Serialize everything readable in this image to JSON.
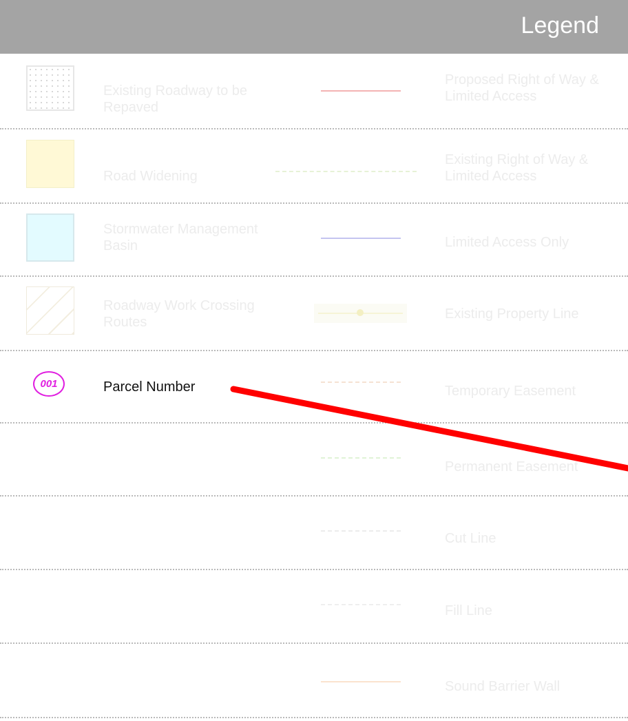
{
  "header": {
    "title": "Legend"
  },
  "left_items": [
    {
      "label": "Existing Roadway to be Repaved",
      "icon": "dotted-hatch-square-icon",
      "color": "#dcdcdc"
    },
    {
      "label": "Road Widening",
      "icon": "yellow-square-icon",
      "color": "#fff9d6"
    },
    {
      "label": "Stormwater Management Basin",
      "icon": "cyan-square-icon",
      "color": "#e3fbff"
    },
    {
      "label": "Roadway Work Crossing Routes",
      "icon": "diagonal-hatch-square-icon",
      "color": "#f3eee0"
    },
    {
      "label": "Parcel Number",
      "icon": "parcel-number-badge-icon",
      "badge_text": "001",
      "color": "#e01fe0"
    }
  ],
  "right_items": [
    {
      "label": "Proposed Right of Way & Limited Access",
      "color": "#f3b3b3"
    },
    {
      "label": "Existing Right of Way & Limited Access",
      "color": "#e6f2d6"
    },
    {
      "label": "Limited Access Only",
      "color": "#c4c4f0"
    },
    {
      "label": "Existing Property Line",
      "color": "#f6f4d6"
    },
    {
      "label": "Temporary Easement",
      "color": "#f5e2d3"
    },
    {
      "label": "Permanent Easement",
      "color": "#e0f3d6"
    },
    {
      "label": "Cut Line",
      "color": "#ececec"
    },
    {
      "label": "Fill Line",
      "color": "#efefef"
    },
    {
      "label": "Sound Barrier Wall",
      "color": "#fbe3ce"
    }
  ],
  "annotation": {
    "icon": "red-arrow-line-icon",
    "color": "#ff0000"
  }
}
